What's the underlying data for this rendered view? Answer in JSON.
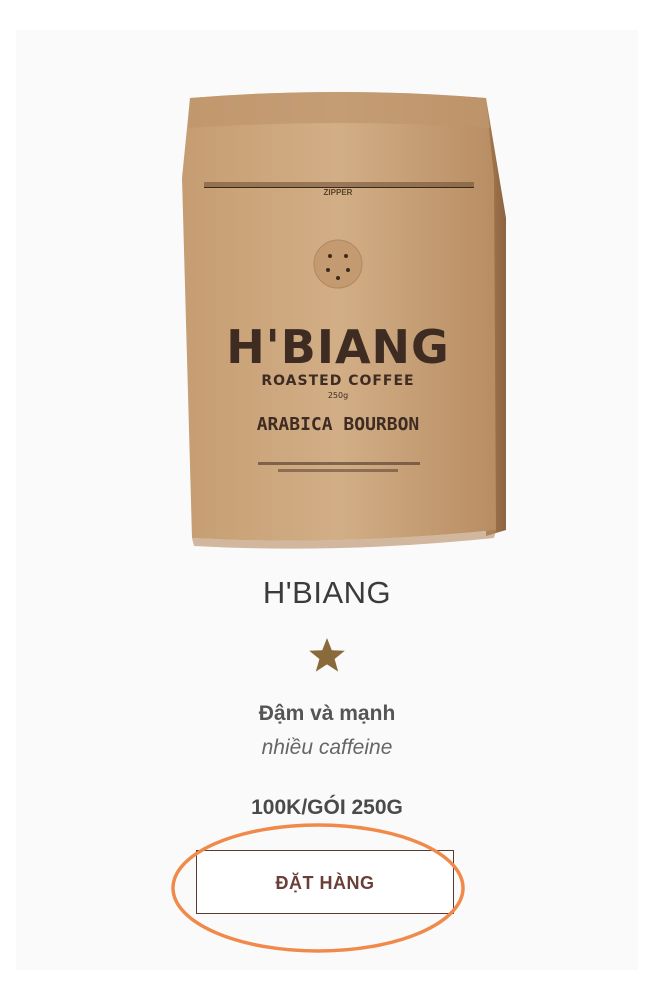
{
  "product": {
    "image": {
      "brand_text": "H'BIANG",
      "subtitle_text": "ROASTED COFFEE",
      "weight_text": "250g",
      "variety_text": "ARABICA BOURBON",
      "zipper_text": "ZIPPER"
    },
    "name": "H'BIANG",
    "rating": {
      "stars": 1,
      "star_color": "#8a6a3a"
    },
    "description_title": "Đậm và mạnh",
    "description_sub": "nhiều caffeine",
    "price": "100K/GÓI 250G",
    "order_button_label": "ĐẶT HÀNG"
  },
  "colors": {
    "bag": "#c9a27a",
    "highlight": "#f08a4b",
    "button_border": "#5a3a34"
  }
}
